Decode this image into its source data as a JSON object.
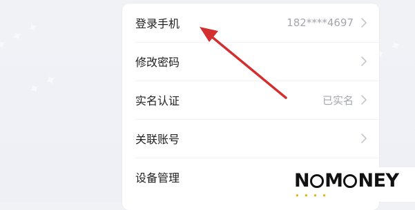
{
  "settings": {
    "rows": [
      {
        "label": "登录手机",
        "value": "182****4697"
      },
      {
        "label": "修改密码",
        "value": ""
      },
      {
        "label": "实名认证",
        "value": "已实名"
      },
      {
        "label": "关联账号",
        "value": ""
      },
      {
        "label": "设备管理",
        "value": ""
      }
    ]
  },
  "logo": {
    "left": "N",
    "middle": "M",
    "right": "NEY"
  },
  "colors": {
    "arrow": "#d32f2f",
    "value_text": "#a3a6ad",
    "label_text": "#1f1f1f",
    "background": "#f1f2f6"
  }
}
